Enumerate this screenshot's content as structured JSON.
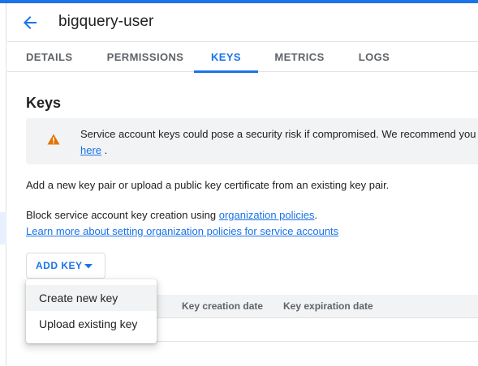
{
  "header": {
    "title": "bigquery-user",
    "back_icon": "arrow-back-icon"
  },
  "tabs": [
    {
      "label": "DETAILS",
      "active": false
    },
    {
      "label": "PERMISSIONS",
      "active": false
    },
    {
      "label": "KEYS",
      "active": true
    },
    {
      "label": "METRICS",
      "active": false
    },
    {
      "label": "LOGS",
      "active": false
    }
  ],
  "keys": {
    "title": "Keys",
    "warning": {
      "icon": "warning-icon",
      "text": "Service account keys could pose a security risk if compromised. We recommend you",
      "link": "here",
      "suffix": "."
    },
    "description": "Add a new key pair or upload a public key certificate from an existing key pair.",
    "policy": {
      "prefix": "Block service account key creation using ",
      "link": "organization policies",
      "suffix": "."
    },
    "learn_more": "Learn more about setting organization policies for service accounts",
    "add_key": {
      "label": "ADD KEY",
      "icon": "caret-down-icon"
    },
    "menu": [
      {
        "label": "Create new key"
      },
      {
        "label": "Upload existing key"
      }
    ],
    "table": {
      "columns": [
        "Key creation date",
        "Key expiration date"
      ]
    }
  },
  "colors": {
    "accent": "#1a73e8",
    "warning": "#e37400",
    "text": "#202124",
    "muted": "#5f6368"
  }
}
